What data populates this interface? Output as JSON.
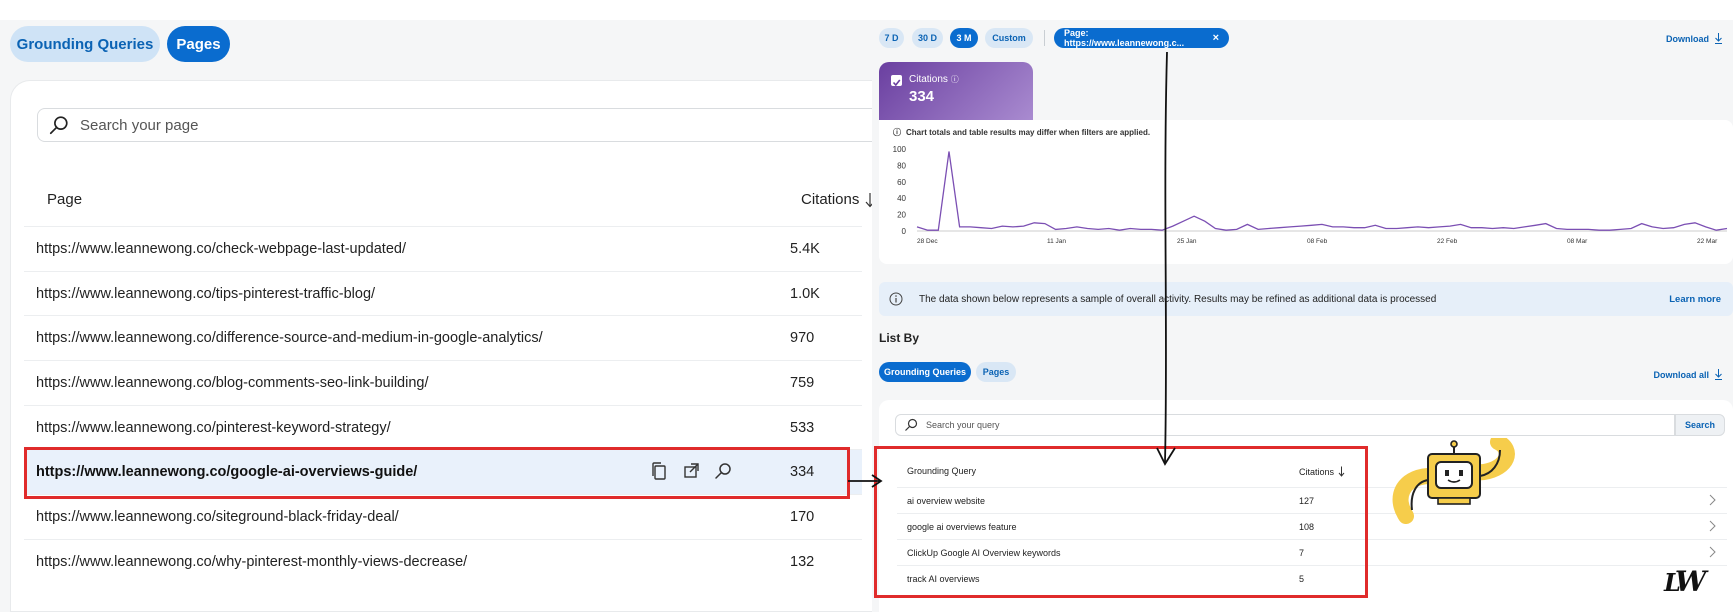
{
  "left": {
    "tabs": [
      {
        "label": "Grounding Queries",
        "active": false
      },
      {
        "label": "Pages",
        "active": true
      }
    ],
    "search_placeholder": "Search your page",
    "col_page": "Page",
    "col_citations": "Citations",
    "rows": [
      {
        "url": "https://www.leannewong.co/check-webpage-last-updated/",
        "citations": "5.4K"
      },
      {
        "url": "https://www.leannewong.co/tips-pinterest-traffic-blog/",
        "citations": "1.0K"
      },
      {
        "url": "https://www.leannewong.co/difference-source-and-medium-in-google-analytics/",
        "citations": "970"
      },
      {
        "url": "https://www.leannewong.co/blog-comments-seo-link-building/",
        "citations": "759"
      },
      {
        "url": "https://www.leannewong.co/pinterest-keyword-strategy/",
        "citations": "533"
      },
      {
        "url": "https://www.leannewong.co/google-ai-overviews-guide/",
        "citations": "334",
        "selected": true
      },
      {
        "url": "https://www.leannewong.co/siteground-black-friday-deal/",
        "citations": "170"
      },
      {
        "url": "https://www.leannewong.co/why-pinterest-monthly-views-decrease/",
        "citations": "132"
      }
    ]
  },
  "right": {
    "ranges": [
      "7 D",
      "30 D",
      "3 M",
      "Custom"
    ],
    "active_range": "3 M",
    "filter_chip": "Page: https://www.leannewong.c...",
    "download": "Download",
    "metric": {
      "label": "Citations",
      "value": "334"
    },
    "chart_note": "Chart totals and table results may differ when filters are applied.",
    "info": "The data shown below represents a sample of overall activity. Results may be refined as additional data is processed",
    "learn_more": "Learn more",
    "list_by": "List By",
    "list_tabs": [
      "Grounding Queries",
      "Pages"
    ],
    "download_all": "Download all",
    "search_placeholder": "Search your query",
    "search_button": "Search",
    "col_query": "Grounding Query",
    "col_citations": "Citations",
    "rows": [
      {
        "query": "ai overview website",
        "citations": "127"
      },
      {
        "query": "google ai overviews feature",
        "citations": "108"
      },
      {
        "query": "ClickUp Google AI Overview keywords",
        "citations": "7"
      },
      {
        "query": "track AI overviews",
        "citations": "5"
      }
    ]
  },
  "chart_data": {
    "type": "line",
    "yticks": [
      0,
      20,
      40,
      60,
      80,
      100
    ],
    "ylim": [
      0,
      100
    ],
    "xtick_labels": [
      "28 Dec",
      "11 Jan",
      "25 Jan",
      "08 Feb",
      "22 Feb",
      "08 Mar",
      "22 Mar"
    ],
    "series": [
      {
        "color": "#7b4fb3",
        "values": [
          5,
          1,
          1,
          97,
          5,
          5,
          4,
          3,
          6,
          5,
          6,
          10,
          9,
          2,
          3,
          5,
          3,
          2,
          3,
          1,
          3,
          2,
          2,
          1,
          6,
          12,
          18,
          12,
          3,
          1,
          2,
          8,
          2,
          3,
          4,
          5,
          6,
          7,
          8,
          5,
          5,
          4,
          4,
          7,
          3,
          3,
          4,
          5,
          4,
          5,
          6,
          8,
          4,
          4,
          3,
          4,
          3,
          5,
          7,
          9,
          3,
          2,
          2,
          2,
          1,
          1,
          2,
          3,
          9,
          5,
          3,
          4,
          8,
          10,
          5,
          1,
          3
        ]
      }
    ]
  },
  "colors": {
    "accent": "#0a6ccf",
    "highlight": "#e02b2b",
    "series": "#7b4fb3"
  },
  "logo": "LW"
}
